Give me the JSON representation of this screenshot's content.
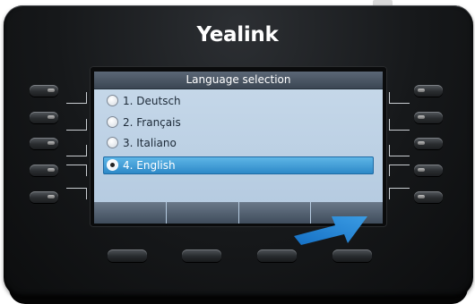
{
  "device": {
    "brand": "Yealink"
  },
  "screen": {
    "title": "Language selection",
    "items": [
      {
        "label": "1. Deutsch",
        "selected": false
      },
      {
        "label": "2. Français",
        "selected": false
      },
      {
        "label": "3. Italiano",
        "selected": false
      },
      {
        "label": "4. English",
        "selected": true
      }
    ],
    "softkeys": [
      "",
      "",
      "",
      ""
    ]
  },
  "colors": {
    "selection": "#2a86c6",
    "screen_bg": "#c2d5e8",
    "title_bar": "#4a5563",
    "arrow": "#1f7fd0"
  },
  "annotation": {
    "icon": "arrow-pointing-softkey-4-icon"
  }
}
